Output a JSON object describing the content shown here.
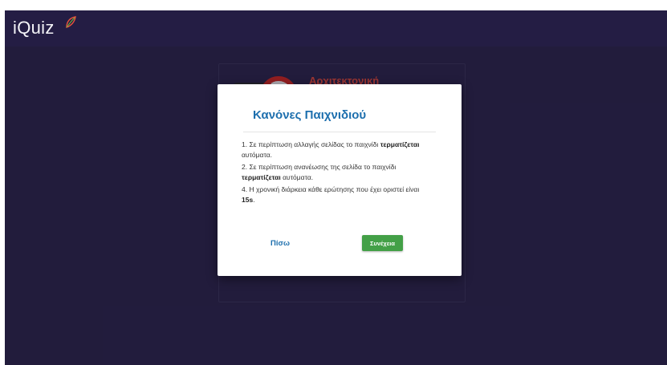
{
  "app": {
    "logo": "iQuiz"
  },
  "background_card": {
    "title": "Αρχιτεκτονική υπολογιστών"
  },
  "modal": {
    "title": "Κανόνες Παιχνιδιού",
    "rules": [
      {
        "before": "1. Σε περίπτωση αλλαγής σελίδας το παιχνίδι ",
        "bold": "τερματίζεται",
        "after": " αυτόματα."
      },
      {
        "before": "2. Σε περίπτωση ανανέωσης της σελίδα το παιχνίδι ",
        "bold": "τερματίζεται",
        "after": " αυτόματα."
      },
      {
        "before": "4. Η χρονική διάρκεια κάθε ερώτησης που έχει οριστεί είναι ",
        "bold": "15s",
        "after": "."
      }
    ],
    "back_label": "Πίσω",
    "continue_label": "Συνέχεια"
  },
  "colors": {
    "page_background": "#2a2349",
    "topbar": "#241d44",
    "modal_title": "#1d6fae",
    "continue_button": "#43a047",
    "card_title": "#e7493a"
  },
  "icons": {
    "logo_leaf": "leaf-icon",
    "card_image": "no-entry-icon"
  }
}
